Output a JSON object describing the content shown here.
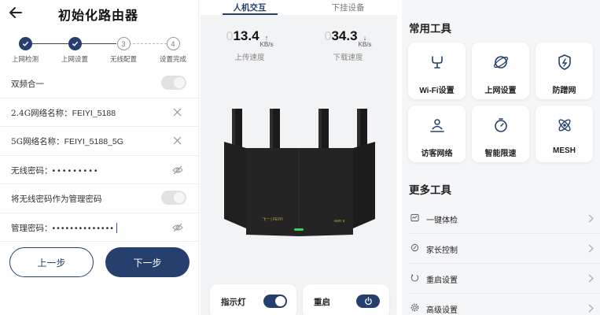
{
  "setup": {
    "title": "初始化路由器",
    "steps": [
      {
        "label": "上网检测",
        "mark": "✓",
        "state": "done"
      },
      {
        "label": "上网设置",
        "mark": "✓",
        "state": "done"
      },
      {
        "label": "无线配置",
        "mark": "3",
        "state": "current"
      },
      {
        "label": "设置完成",
        "mark": "4",
        "state": "todo"
      }
    ],
    "dual_band": {
      "label": "双频合一",
      "on": false
    },
    "ssid_24g": {
      "label": "2.4G网络名称：",
      "value": "FEIYI_5188"
    },
    "ssid_5g": {
      "label": "5G网络名称：",
      "value": "FEIYI_5188_5G"
    },
    "wifi_password": {
      "label": "无线密码：",
      "value": "•••••••••"
    },
    "use_as_admin": {
      "label": "将无线密码作为管理密码",
      "on": false
    },
    "admin_password": {
      "label": "管理密码：",
      "value": "••••••••••••••"
    },
    "prev_label": "上一步",
    "next_label": "下一步"
  },
  "device": {
    "tabs": [
      {
        "label": "人机交互",
        "active": true
      },
      {
        "label": "下挂设备",
        "active": false
      }
    ],
    "upload": {
      "zero": "0",
      "value": "13.4",
      "unit": "KB/s",
      "arrow": "↑",
      "label": "上传速度"
    },
    "download": {
      "zero": "0",
      "value": "34.3",
      "unit": "KB/s",
      "arrow": "↓",
      "label": "下载速度"
    },
    "router_brand": "飞一 | FEIYI",
    "router_model": "WIFI 6",
    "indicator": {
      "label": "指示灯",
      "on": true
    },
    "reboot": {
      "label": "重启"
    }
  },
  "tools": {
    "common_title": "常用工具",
    "common": [
      {
        "label": "Wi-Fi设置",
        "icon": "wifi-settings-icon"
      },
      {
        "label": "上网设置",
        "icon": "internet-settings-icon"
      },
      {
        "label": "防蹭网",
        "icon": "shield-icon"
      },
      {
        "label": "访客网络",
        "icon": "guest-network-icon"
      },
      {
        "label": "智能限速",
        "icon": "speed-limit-icon"
      },
      {
        "label": "MESH",
        "icon": "mesh-icon"
      }
    ],
    "more_title": "更多工具",
    "more": [
      {
        "label": "一键体检",
        "icon": "health-check-icon"
      },
      {
        "label": "家长控制",
        "icon": "parental-control-icon"
      },
      {
        "label": "重启设置",
        "icon": "restart-icon"
      },
      {
        "label": "高级设置",
        "icon": "gear-icon"
      }
    ]
  },
  "colors": {
    "accent": "#26406e",
    "toggle_off": "#e2e2e2",
    "panel_bg": "#f2f3f5"
  }
}
